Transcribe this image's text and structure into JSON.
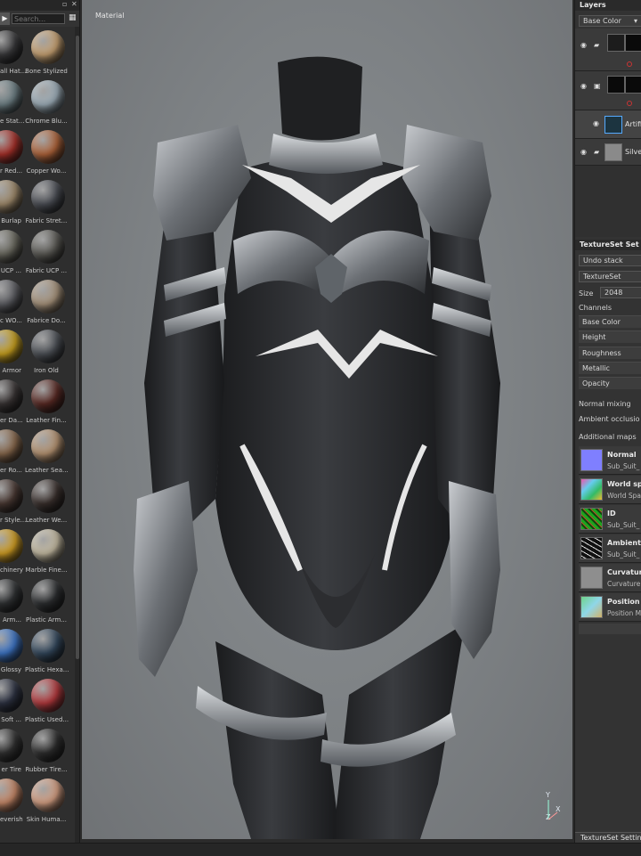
{
  "shelf": {
    "search_placeholder": "Search...",
    "materials": [
      {
        "label": "all Hat...",
        "color": "#3a3a3c"
      },
      {
        "label": "Bone Stylized",
        "color": "#c9a373"
      },
      {
        "label": "e Stat...",
        "color": "#6f8186"
      },
      {
        "label": "Chrome Blu...",
        "color": "#9fb0bb"
      },
      {
        "label": "r Red...",
        "color": "#a8312a"
      },
      {
        "label": "Copper Wo...",
        "color": "#b0643a"
      },
      {
        "label": "Burlap",
        "color": "#a08b6c"
      },
      {
        "label": "Fabric Stret...",
        "color": "#4b4e55"
      },
      {
        "label": "UCP ...",
        "color": "#6b6a60"
      },
      {
        "label": "Fabric UCP ...",
        "color": "#5b5a55"
      },
      {
        "label": "c WO...",
        "color": "#5f6065"
      },
      {
        "label": "Fabrice Do...",
        "color": "#a8947c"
      },
      {
        "label": "Armor",
        "color": "#c9a11f"
      },
      {
        "label": "Iron Old",
        "color": "#4d5157"
      },
      {
        "label": "er Da...",
        "color": "#3a3535"
      },
      {
        "label": "Leather Fin...",
        "color": "#5a2a24"
      },
      {
        "label": "er Ro...",
        "color": "#8a6a4e"
      },
      {
        "label": "Leather Sea...",
        "color": "#b89573"
      },
      {
        "label": "r Style...",
        "color": "#4b3a34"
      },
      {
        "label": "Leather We...",
        "color": "#3a302d"
      },
      {
        "label": "chinery",
        "color": "#d3a024"
      },
      {
        "label": "Marble Fine...",
        "color": "#c7bda4"
      },
      {
        "label": "Arm...",
        "color": "#323436"
      },
      {
        "label": "Plastic Arm...",
        "color": "#2d2f31"
      },
      {
        "label": "Glossy",
        "color": "#3f77c9"
      },
      {
        "label": "Plastic Hexa...",
        "color": "#34495e"
      },
      {
        "label": "Soft ...",
        "color": "#2f3444"
      },
      {
        "label": "Plastic Used...",
        "color": "#b63a3e"
      },
      {
        "label": "er Tire",
        "color": "#333333"
      },
      {
        "label": "Rubber Tire...",
        "color": "#2e2e2e"
      },
      {
        "label": "everish",
        "color": "#c98a6a"
      },
      {
        "label": "Skin Huma...",
        "color": "#d7a184"
      }
    ]
  },
  "viewport": {
    "title": "Material",
    "axis": {
      "y": "Y",
      "x": "X",
      "z": "Z"
    }
  },
  "layers": {
    "title": "Layers",
    "channel_select": "Base Color",
    "items": [
      {
        "name": "",
        "kind": "folder"
      },
      {
        "name": "",
        "kind": "folder-mask"
      },
      {
        "name": "Artifi",
        "kind": "fill"
      },
      {
        "name": "Silve",
        "kind": "folder"
      }
    ]
  },
  "textureset": {
    "title": "TextureSet Set",
    "undo_stack": "Undo stack",
    "textureset_select": "TextureSet",
    "size_label": "Size",
    "size_value": "2048",
    "channels_label": "Channels",
    "channels": [
      "Base Color",
      "Height",
      "Roughness",
      "Metallic",
      "Opacity"
    ],
    "normal_mixing": "Normal mixing",
    "ambient_occlusion": "Ambient occlusio",
    "additional_maps": "Additional maps",
    "maps": [
      {
        "title": "Normal",
        "sub": "Sub_Suit_",
        "color": "#7f7fff"
      },
      {
        "title": "World sp",
        "sub": "World Spa",
        "color": "#6fbfb4"
      },
      {
        "title": "ID",
        "sub": "Sub_Suit_",
        "color": "#1ea51e"
      },
      {
        "title": "Ambient",
        "sub": "Sub_Suit_",
        "color": "#1a1a1a"
      },
      {
        "title": "Curvatur",
        "sub": "Curvature",
        "color": "#8e8e8e"
      },
      {
        "title": "Position",
        "sub": "Position M",
        "color": "#6fd28a"
      }
    ]
  },
  "bottom_tab": "TextureSet Settin"
}
